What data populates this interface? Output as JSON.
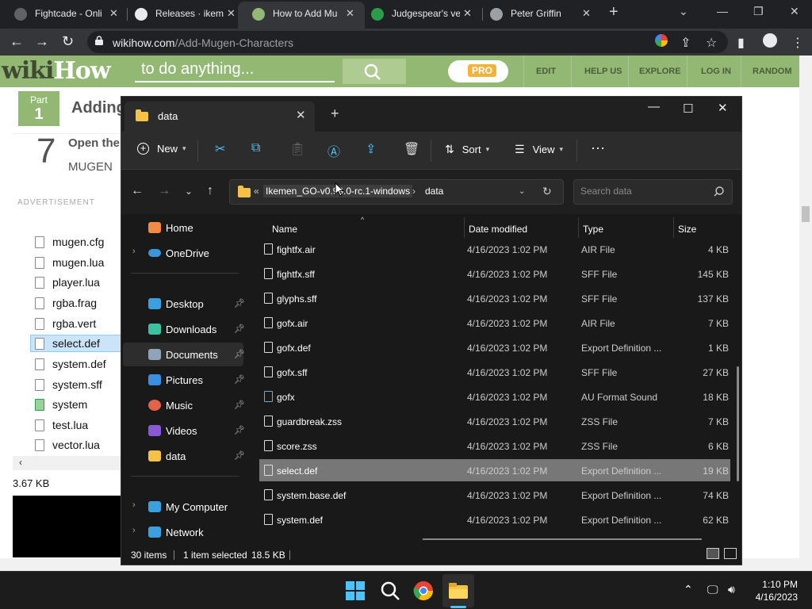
{
  "browser": {
    "tabs": [
      {
        "title": "Fightcade - Onli",
        "favicon_color": "#e8eaed",
        "icon": "gear-icon"
      },
      {
        "title": "Releases · ikeme",
        "favicon_color": "#ffffff",
        "icon": "github-icon"
      },
      {
        "title": "How to Add Mu",
        "favicon_color": "#93b874",
        "icon": "wikihow-icon",
        "active": true
      },
      {
        "title": "Judgespear's ve",
        "favicon_color": "#2a9d4a",
        "icon": "site-icon"
      },
      {
        "title": "Peter Griffin",
        "favicon_color": "#9aa0a6",
        "icon": "globe-icon"
      }
    ],
    "url_host": "wikihow.com",
    "url_path": "/Add-Mugen-Characters"
  },
  "wikihow": {
    "tagline": "to do anything...",
    "pro": "PRO",
    "nav": [
      "EDIT",
      "HELP US",
      "EXPLORE",
      "LOG IN",
      "RANDOM"
    ],
    "part_label": "Part",
    "part_number": "1",
    "heading": "Adding",
    "step_number": "7",
    "step_title": "Open the",
    "step_sub": "MUGEN",
    "advertisement": "ADVERTISEMENT",
    "screenshot_files": [
      "mugen.cfg",
      "mugen.lua",
      "player.lua",
      "rgba.frag",
      "rgba.vert",
      "select.def",
      "system.def",
      "system.sff",
      "system",
      "test.lua",
      "vector.lua"
    ],
    "screenshot_selected": "select.def",
    "screenshot_size": "3.67 KB"
  },
  "explorer": {
    "tab_title": "data",
    "commands": {
      "new": "New",
      "sort": "Sort",
      "view": "View"
    },
    "breadcrumb": [
      "Ikemen_GO-v0.99.0-rc.1-windows",
      "data"
    ],
    "search_placeholder": "Search data",
    "nav": [
      {
        "label": "Home",
        "icon": "home-icon",
        "color": "#f58a42"
      },
      {
        "label": "OneDrive",
        "icon": "cloud-icon",
        "color": "#3a96dd"
      },
      {
        "label": "Desktop",
        "icon": "desktop-icon",
        "color": "#3aa0e0"
      },
      {
        "label": "Downloads",
        "icon": "download-icon",
        "color": "#3ac1a0"
      },
      {
        "label": "Documents",
        "icon": "documents-icon",
        "color": "#8fa4b8"
      },
      {
        "label": "Pictures",
        "icon": "pictures-icon",
        "color": "#3a8fe0"
      },
      {
        "label": "Music",
        "icon": "music-icon",
        "color": "#e0634a"
      },
      {
        "label": "Videos",
        "icon": "videos-icon",
        "color": "#8a5ad6"
      },
      {
        "label": "data",
        "icon": "folder-icon",
        "color": "#f6c244"
      },
      {
        "label": "My Computer",
        "icon": "computer-icon",
        "color": "#3aa0e0"
      },
      {
        "label": "Network",
        "icon": "network-icon",
        "color": "#3aa0e0"
      }
    ],
    "columns": [
      "Name",
      "Date modified",
      "Type",
      "Size"
    ],
    "files": [
      {
        "name": "fightfx.air",
        "date": "4/16/2023 1:02 PM",
        "type": "AIR File",
        "size": "4 KB"
      },
      {
        "name": "fightfx.sff",
        "date": "4/16/2023 1:02 PM",
        "type": "SFF File",
        "size": "145 KB"
      },
      {
        "name": "glyphs.sff",
        "date": "4/16/2023 1:02 PM",
        "type": "SFF File",
        "size": "137 KB"
      },
      {
        "name": "gofx.air",
        "date": "4/16/2023 1:02 PM",
        "type": "AIR File",
        "size": "7 KB"
      },
      {
        "name": "gofx.def",
        "date": "4/16/2023 1:02 PM",
        "type": "Export Definition ...",
        "size": "1 KB"
      },
      {
        "name": "gofx.sff",
        "date": "4/16/2023 1:02 PM",
        "type": "SFF File",
        "size": "27 KB"
      },
      {
        "name": "gofx",
        "date": "4/16/2023 1:02 PM",
        "type": "AU Format Sound",
        "size": "18 KB"
      },
      {
        "name": "guardbreak.zss",
        "date": "4/16/2023 1:02 PM",
        "type": "ZSS File",
        "size": "7 KB"
      },
      {
        "name": "score.zss",
        "date": "4/16/2023 1:02 PM",
        "type": "ZSS File",
        "size": "6 KB"
      },
      {
        "name": "select.def",
        "date": "4/16/2023 1:02 PM",
        "type": "Export Definition ...",
        "size": "19 KB"
      },
      {
        "name": "system.base.def",
        "date": "4/16/2023 1:02 PM",
        "type": "Export Definition ...",
        "size": "74 KB"
      },
      {
        "name": "system.def",
        "date": "4/16/2023 1:02 PM",
        "type": "Export Definition ...",
        "size": "62 KB"
      }
    ],
    "selected_file": "select.def",
    "status": {
      "items": "30 items",
      "selected": "1 item selected",
      "size": "18.5 KB"
    }
  },
  "taskbar": {
    "time": "1:10 PM",
    "date": "4/16/2023"
  }
}
